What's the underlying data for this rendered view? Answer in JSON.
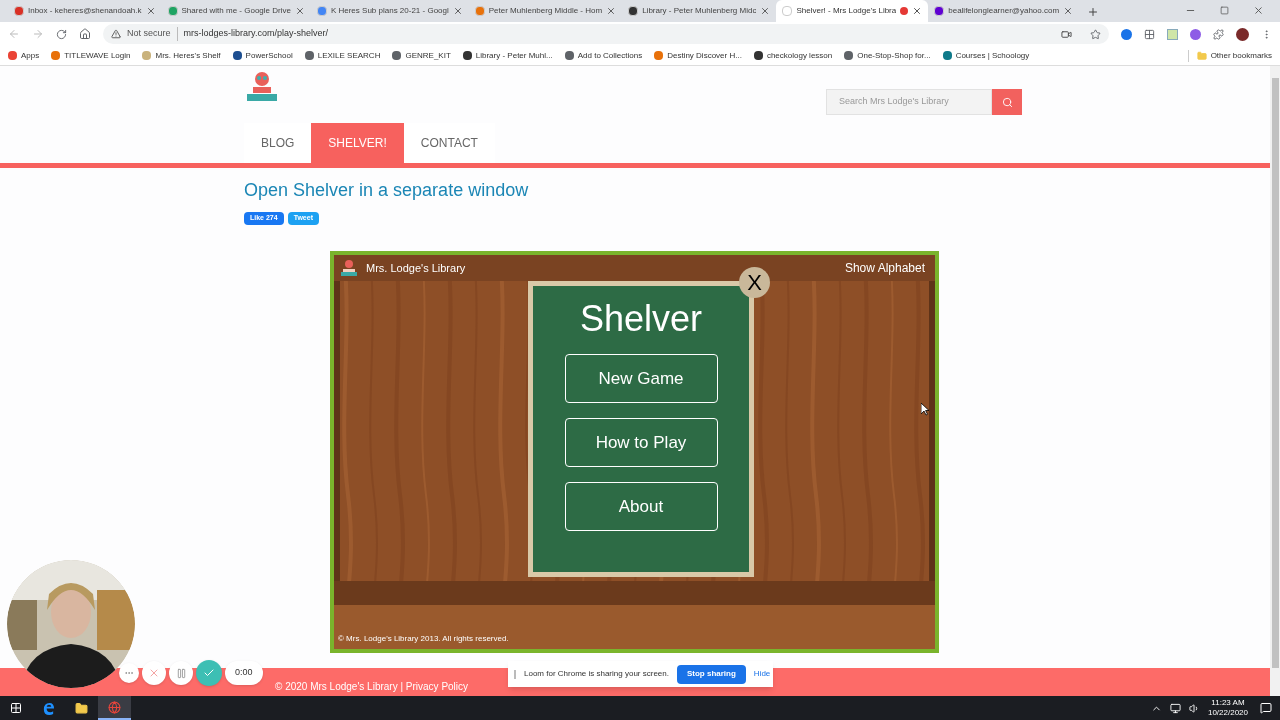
{
  "browser": {
    "tabs": [
      {
        "title": "Inbox - keheres@shenandoah.k",
        "selected": false,
        "recording": false
      },
      {
        "title": "Shared with me - Google Drive",
        "selected": false,
        "recording": false
      },
      {
        "title": "K Heres Sub plans 20-21 - Googl",
        "selected": false,
        "recording": false
      },
      {
        "title": "Peter Muhlenberg Middle - Hom",
        "selected": false,
        "recording": false
      },
      {
        "title": "Library - Peter Muhlenberg Midc",
        "selected": false,
        "recording": false
      },
      {
        "title": "Shelver! - Mrs Lodge's Libra",
        "selected": true,
        "recording": true
      },
      {
        "title": "bealifelonglearner@yahoo.com",
        "selected": false,
        "recording": false
      }
    ],
    "security": "Not secure",
    "url": "mrs-lodges-library.com/play-shelver/",
    "bookmarks": [
      {
        "label": "Apps"
      },
      {
        "label": "TITLEWAVE Login"
      },
      {
        "label": "Mrs. Heres's Shelf"
      },
      {
        "label": "PowerSchool"
      },
      {
        "label": "LEXILE SEARCH"
      },
      {
        "label": "GENRE_KIT"
      },
      {
        "label": "Library - Peter Muhl..."
      },
      {
        "label": "Add to Collections"
      },
      {
        "label": "Destiny Discover H..."
      },
      {
        "label": "checkology lesson"
      },
      {
        "label": "One-Stop-Shop for..."
      },
      {
        "label": "Courses | Schoology"
      }
    ],
    "other_bookmarks": "Other bookmarks"
  },
  "site": {
    "search": {
      "placeholder": "Search Mrs Lodge's Library"
    },
    "nav": [
      {
        "label": "BLOG",
        "selected": false
      },
      {
        "label": "SHELVER!",
        "selected": true
      },
      {
        "label": "CONTACT",
        "selected": false
      }
    ],
    "heading": "Open Shelver in a separate window",
    "like": "Like 274",
    "tweet": "Tweet",
    "footer": "© 2020 Mrs Lodge's Library | Privacy Policy"
  },
  "game": {
    "brand": "Mrs. Lodge's Library",
    "show_alphabet": "Show Alphabet",
    "title": "Shelver",
    "close": "X",
    "menu": [
      "New Game",
      "How to Play",
      "About"
    ],
    "copyright": "© Mrs. Lodge's Library 2013. All rights reserved."
  },
  "loom": {
    "timer": "0:00",
    "message": "Loom for Chrome is sharing your screen.",
    "stop": "Stop sharing",
    "hide": "Hide"
  },
  "taskbar": {
    "time": "11:23 AM",
    "date": "10/22/2020"
  }
}
